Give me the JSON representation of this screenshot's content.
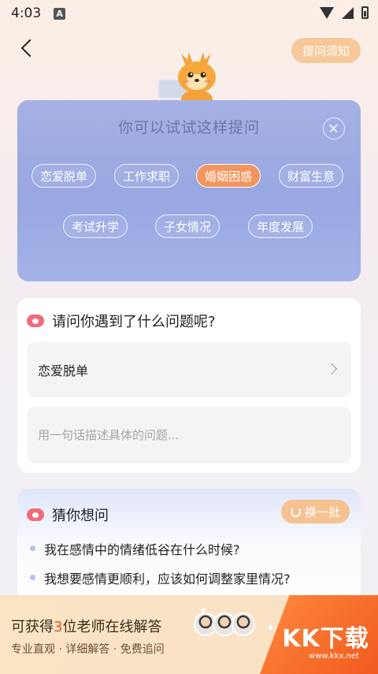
{
  "status_bar": {
    "time": "4:03",
    "notification_letter": "A"
  },
  "header": {
    "notice_label": "提问须知"
  },
  "suggest": {
    "title": "你可以试试这样提问",
    "tags": [
      "恋爱脱单",
      "工作求职",
      "婚姻困惑",
      "财富生意",
      "考试升学",
      "子女情况",
      "年度发展"
    ],
    "active_tag": "婚姻困惑"
  },
  "question": {
    "title": "请问你遇到了什么问题呢?",
    "selected_category": "恋爱脱单",
    "describe_placeholder": "用一句话描述具体的问题..."
  },
  "guess": {
    "title": "猜你想问",
    "refresh_label": "换一批",
    "items": [
      "我在感情中的情绪低谷在什么时候?",
      "我想要感情更顺利，应该如何调整家里情况?"
    ]
  },
  "promo": {
    "line1_prefix": "可获得",
    "line1_highlight": "3",
    "line1_suffix": "位老师在线解答",
    "line2": "专业直观 · 详细解答 · 免费追问",
    "watermark": "KK下载",
    "watermark_url": "www.kkx.net"
  },
  "colors": {
    "accent_orange": "#f3955e",
    "card_blue": "#a6b1e4",
    "highlight_red": "#f04c1c"
  }
}
